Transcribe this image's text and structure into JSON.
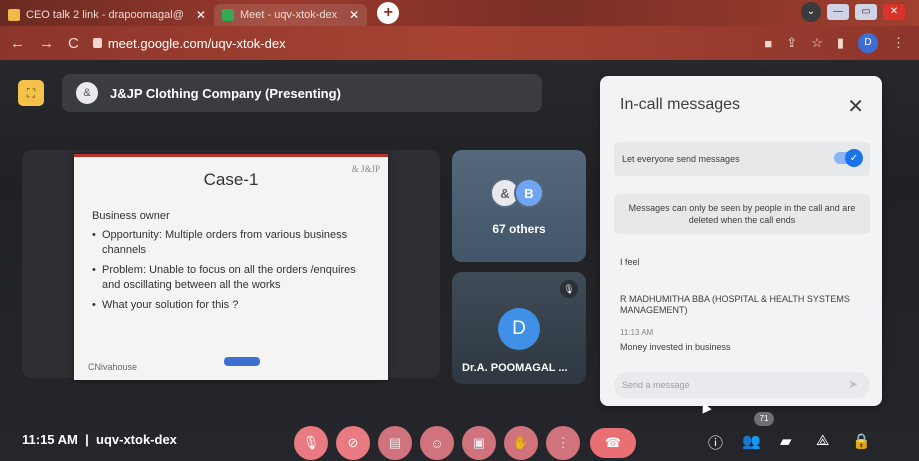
{
  "browser": {
    "tabs": [
      {
        "label": "CEO talk 2 link - drapoomagal@"
      },
      {
        "label": "Meet - uqv-xtok-dex"
      }
    ],
    "url": "meet.google.com/uqv-xtok-dex",
    "profile_initial": "D"
  },
  "meet": {
    "presenting_title": "J&JP Clothing Company (Presenting)",
    "slide": {
      "title": "Case-1",
      "brand": "& J&JP",
      "subtitle": "Business owner",
      "bullets": [
        "Opportunity: Multiple orders from various business channels",
        "Problem: Unable to focus on all the orders /enquires and oscillating between all the works",
        "What your solution for this ?"
      ],
      "footer_logo": "CNivahouse"
    },
    "tiles": {
      "others_initial": "B",
      "others_label": "67 others",
      "person_initial": "D",
      "person_name": "Dr.A. POOMAGAL ..."
    },
    "bottom": {
      "time": "11:15 AM",
      "meeting_code": "uqv-xtok-dex",
      "participant_count": "71"
    }
  },
  "chat": {
    "title": "In-call messages",
    "toggle_label": "Let everyone send messages",
    "toggle_on": true,
    "notice": "Messages can only be seen by people in the call and are deleted when the call ends",
    "messages": [
      {
        "text": "I feel"
      },
      {
        "sender": "R MADHUMITHA BBA (HOSPITAL & HEALTH SYSTEMS MANAGEMENT)",
        "time": "11:13 AM",
        "text": "Money invested in business"
      }
    ],
    "input_placeholder": "Send a message"
  },
  "colors": {
    "browser_frame": "#9a3a2c",
    "accent_blue": "#1a73e8",
    "control_red": "#ea6f74",
    "present_yellow": "#f4c24a"
  }
}
